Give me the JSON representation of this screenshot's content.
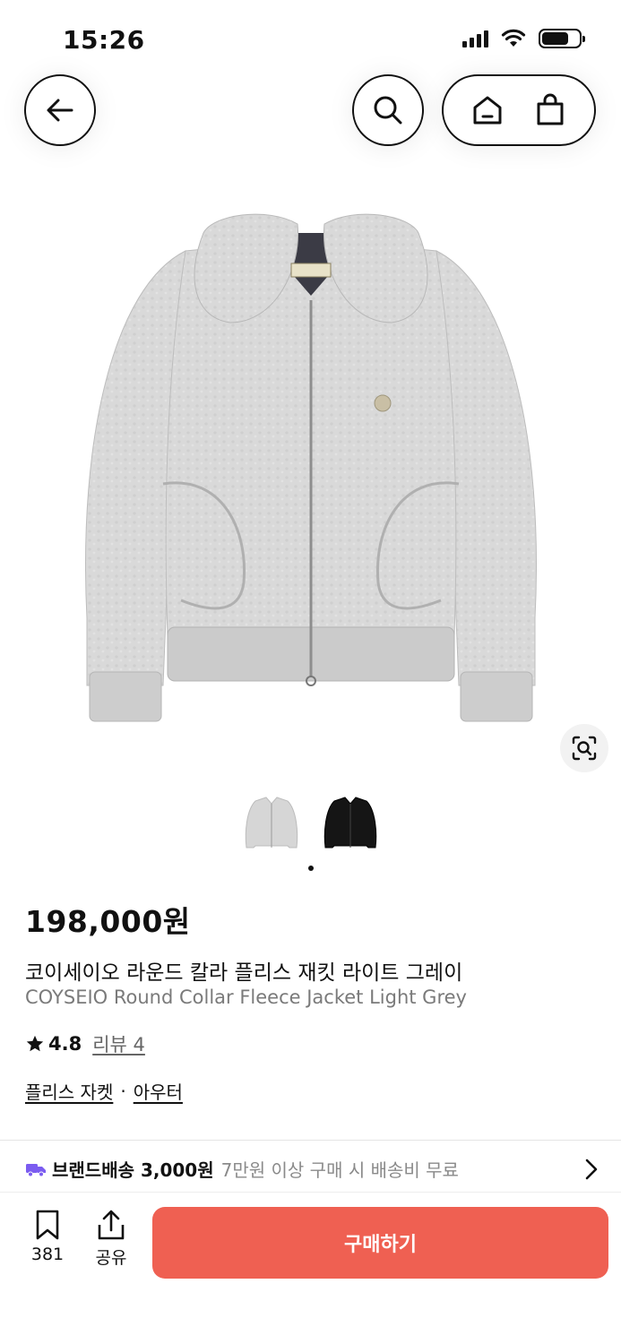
{
  "status_bar": {
    "time": "15:26"
  },
  "product": {
    "price": "198,000원",
    "name_ko": "코이세이오 라운드 칼라 플리스 재킷 라이트 그레이",
    "name_en": "COYSEIO Round Collar Fleece Jacket Light Grey",
    "rating": "4.8",
    "review_label": "리뷰 4",
    "category": "플리스 자켓",
    "category_sep": "·",
    "category_parent": "아우터",
    "brand_label": "COYSEIO"
  },
  "delivery": {
    "title": "브랜드배송 3,000원",
    "condition": "7만원 이상 구매 시 배송비 무료"
  },
  "bottom_bar": {
    "bookmark_count": "381",
    "share_label": "공유",
    "buy_label": "구매하기"
  },
  "colors": {
    "accent": "#ef6052",
    "delivery_icon": "#7b5cf0",
    "jacket_light": "#d6d6d6",
    "jacket_dark": "#151515"
  },
  "icons": [
    "back-arrow-icon",
    "search-icon",
    "home-icon",
    "shopping-bag-icon",
    "image-search-icon",
    "star-icon",
    "delivery-truck-icon",
    "chevron-right-icon",
    "bookmark-icon",
    "share-icon"
  ]
}
